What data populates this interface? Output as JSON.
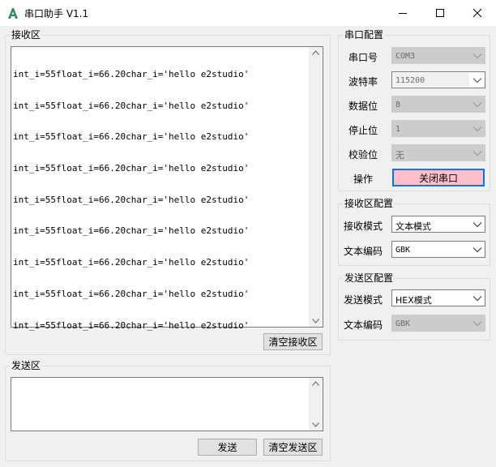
{
  "window": {
    "title": "串口助手 V1.1"
  },
  "receive": {
    "legend": "接收区",
    "lines": [
      "int_i=55float_i=66.20char_i='hello e2studio'",
      "int_i=55float_i=66.20char_i='hello e2studio'",
      "int_i=55float_i=66.20char_i='hello e2studio'",
      "int_i=55float_i=66.20char_i='hello e2studio'",
      "int_i=55float_i=66.20char_i='hello e2studio'",
      "int_i=55float_i=66.20char_i='hello e2studio'",
      "int_i=55float_i=66.20char_i='hello e2studio'",
      "int_i=55float_i=66.20char_i='hello e2studio'",
      "int_i=55float_i=66.20char_i='hello e2studio'"
    ],
    "clear_label": "清空接收区"
  },
  "send": {
    "legend": "发送区",
    "value": "",
    "send_label": "发送",
    "clear_label": "清空发送区"
  },
  "serial": {
    "legend": "串口配置",
    "port_label": "串口号",
    "port_value": "COM3",
    "baud_label": "波特率",
    "baud_value": "115200",
    "databits_label": "数据位",
    "databits_value": "8",
    "stopbits_label": "停止位",
    "stopbits_value": "1",
    "parity_label": "校验位",
    "parity_value": "无",
    "action_label": "操作",
    "action_button": "关闭串口"
  },
  "rx_config": {
    "legend": "接收区配置",
    "mode_label": "接收模式",
    "mode_value": "文本模式",
    "encoding_label": "文本编码",
    "encoding_value": "GBK"
  },
  "tx_config": {
    "legend": "发送区配置",
    "mode_label": "发送模式",
    "mode_value": "HEX模式",
    "encoding_label": "文本编码",
    "encoding_value": "GBK"
  },
  "colors": {
    "close_button_bg": "#ffc0cb",
    "focus_border": "#0078d7"
  }
}
